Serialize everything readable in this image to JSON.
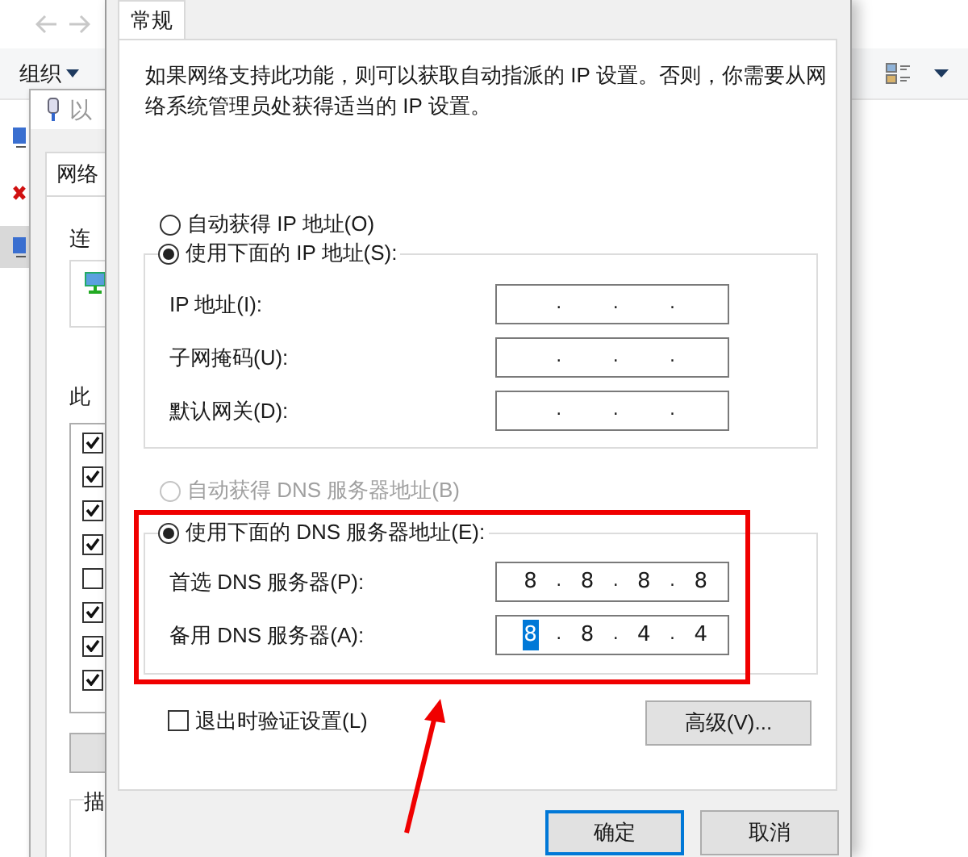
{
  "explorer": {
    "organize_button": "组织",
    "nav_items": [
      {
        "kind": "adapter",
        "selected": false
      },
      {
        "kind": "disconnected",
        "selected": false
      },
      {
        "kind": "adapter",
        "selected": true
      }
    ]
  },
  "properties_window": {
    "title": "以",
    "tab": "网络",
    "connect_label": "连",
    "list_label": "此",
    "description_label": "描",
    "components": [
      {
        "checked": true
      },
      {
        "checked": true
      },
      {
        "checked": true
      },
      {
        "checked": true
      },
      {
        "checked": false
      },
      {
        "checked": true
      },
      {
        "checked": true
      },
      {
        "checked": true
      }
    ]
  },
  "ipv4_dialog": {
    "tab": {
      "label": "常规",
      "selected": true
    },
    "description": "如果网络支持此功能，则可以获取自动指派的 IP 设置。否则，你需要从网络系统管理员处获得适当的 IP 设置。",
    "ip_mode": [
      {
        "label": "自动获得 IP 地址(O)",
        "selected": false,
        "disabled": false
      },
      {
        "label": "使用下面的 IP 地址(S):",
        "selected": true,
        "disabled": false
      }
    ],
    "ip_fields": [
      {
        "label": "IP 地址(I):",
        "separator": "."
      },
      {
        "label": "子网掩码(U):",
        "separator": "."
      },
      {
        "label": "默认网关(D):",
        "separator": "."
      }
    ],
    "dns_mode": [
      {
        "label": "自动获得 DNS 服务器地址(B)",
        "selected": false,
        "disabled": true
      },
      {
        "label": "使用下面的 DNS 服务器地址(E):",
        "selected": true,
        "disabled": false
      }
    ],
    "dns_fields": [
      {
        "label": "首选 DNS 服务器(P):",
        "separator": ".",
        "octets": [
          {
            "text": "8",
            "selected": false
          },
          {
            "text": "8",
            "selected": false
          },
          {
            "text": "8",
            "selected": false
          },
          {
            "text": "8",
            "selected": false
          }
        ]
      },
      {
        "label": "备用 DNS 服务器(A):",
        "separator": ".",
        "octets": [
          {
            "text": "8",
            "selected": true
          },
          {
            "text": "8",
            "selected": false
          },
          {
            "text": "4",
            "selected": false
          },
          {
            "text": "4",
            "selected": false
          }
        ]
      }
    ],
    "validate_on_exit": {
      "label": "退出时验证设置(L)",
      "checked": false
    },
    "advanced_button": "高级(V)...",
    "buttons": [
      {
        "label": "确定",
        "focused": true
      },
      {
        "label": "取消",
        "focused": false
      }
    ]
  }
}
